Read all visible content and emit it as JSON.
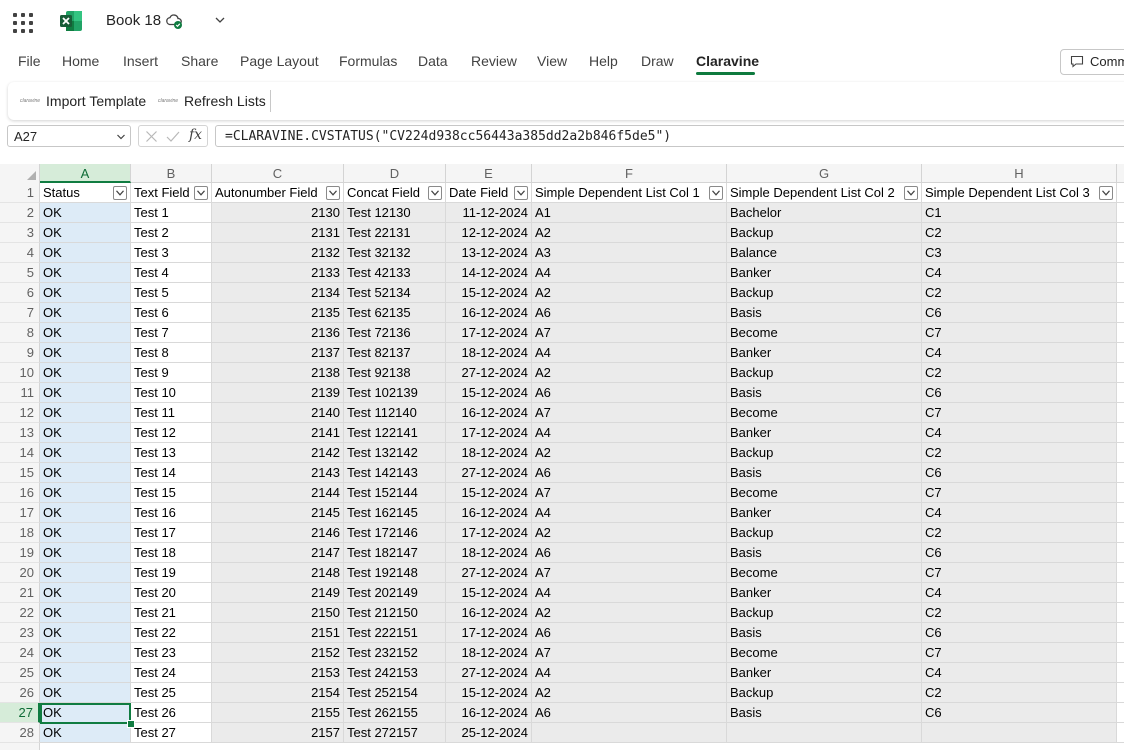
{
  "app": {
    "title": "Book 18",
    "icons": {
      "launcher": "app-launcher-icon",
      "logo": "excel-logo-icon",
      "sync": "cloud-saved-icon",
      "more": "chevron-down-icon"
    },
    "accent": "#107c41"
  },
  "menu": {
    "items": [
      "File",
      "Home",
      "Insert",
      "Share",
      "Page Layout",
      "Formulas",
      "Data",
      "Review",
      "View",
      "Help",
      "Draw",
      "Claravine"
    ],
    "active": "Claravine",
    "comments_label": "Comm"
  },
  "ribbon": {
    "logo_text": "claravine",
    "import_label": "Import Template",
    "refresh_label": "Refresh Lists"
  },
  "formula_bar": {
    "name_box": "A27",
    "fx": "fx",
    "formula": "=CLARAVINE.CVSTATUS(\"CV224d938cc56443a385dd2a2b846f5de5\")"
  },
  "sheet": {
    "columns": [
      "A",
      "B",
      "C",
      "D",
      "E",
      "F",
      "G",
      "H"
    ],
    "selected_column": "A",
    "selected_row": 27,
    "headers": [
      "Status",
      "Text Field",
      "Autonumber Field",
      "Concat Field",
      "Date Field",
      "Simple Dependent List Col 1",
      "Simple Dependent List Col 2",
      "Simple Dependent List Col 3"
    ],
    "rows": [
      {
        "n": "2",
        "cells": [
          "OK",
          "Test 1",
          "2130",
          "Test 12130",
          "11-12-2024",
          "A1",
          "Bachelor",
          "C1"
        ]
      },
      {
        "n": "3",
        "cells": [
          "OK",
          "Test 2",
          "2131",
          "Test 22131",
          "12-12-2024",
          "A2",
          "Backup",
          "C2"
        ]
      },
      {
        "n": "4",
        "cells": [
          "OK",
          "Test 3",
          "2132",
          "Test 32132",
          "13-12-2024",
          "A3",
          "Balance",
          "C3"
        ]
      },
      {
        "n": "5",
        "cells": [
          "OK",
          "Test 4",
          "2133",
          "Test 42133",
          "14-12-2024",
          "A4",
          "Banker",
          "C4"
        ]
      },
      {
        "n": "6",
        "cells": [
          "OK",
          "Test 5",
          "2134",
          "Test 52134",
          "15-12-2024",
          "A2",
          "Backup",
          "C2"
        ]
      },
      {
        "n": "7",
        "cells": [
          "OK",
          "Test 6",
          "2135",
          "Test 62135",
          "16-12-2024",
          "A6",
          "Basis",
          "C6"
        ]
      },
      {
        "n": "8",
        "cells": [
          "OK",
          "Test 7",
          "2136",
          "Test 72136",
          "17-12-2024",
          "A7",
          "Become",
          "C7"
        ]
      },
      {
        "n": "9",
        "cells": [
          "OK",
          "Test 8",
          "2137",
          "Test 82137",
          "18-12-2024",
          "A4",
          "Banker",
          "C4"
        ]
      },
      {
        "n": "10",
        "cells": [
          "OK",
          "Test 9",
          "2138",
          "Test 92138",
          "27-12-2024",
          "A2",
          "Backup",
          "C2"
        ]
      },
      {
        "n": "11",
        "cells": [
          "OK",
          "Test 10",
          "2139",
          "Test 102139",
          "15-12-2024",
          "A6",
          "Basis",
          "C6"
        ]
      },
      {
        "n": "12",
        "cells": [
          "OK",
          "Test 11",
          "2140",
          "Test 112140",
          "16-12-2024",
          "A7",
          "Become",
          "C7"
        ]
      },
      {
        "n": "13",
        "cells": [
          "OK",
          "Test 12",
          "2141",
          "Test 122141",
          "17-12-2024",
          "A4",
          "Banker",
          "C4"
        ]
      },
      {
        "n": "14",
        "cells": [
          "OK",
          "Test 13",
          "2142",
          "Test 132142",
          "18-12-2024",
          "A2",
          "Backup",
          "C2"
        ]
      },
      {
        "n": "15",
        "cells": [
          "OK",
          "Test 14",
          "2143",
          "Test 142143",
          "27-12-2024",
          "A6",
          "Basis",
          "C6"
        ]
      },
      {
        "n": "16",
        "cells": [
          "OK",
          "Test 15",
          "2144",
          "Test 152144",
          "15-12-2024",
          "A7",
          "Become",
          "C7"
        ]
      },
      {
        "n": "17",
        "cells": [
          "OK",
          "Test 16",
          "2145",
          "Test 162145",
          "16-12-2024",
          "A4",
          "Banker",
          "C4"
        ]
      },
      {
        "n": "18",
        "cells": [
          "OK",
          "Test 17",
          "2146",
          "Test 172146",
          "17-12-2024",
          "A2",
          "Backup",
          "C2"
        ]
      },
      {
        "n": "19",
        "cells": [
          "OK",
          "Test 18",
          "2147",
          "Test 182147",
          "18-12-2024",
          "A6",
          "Basis",
          "C6"
        ]
      },
      {
        "n": "20",
        "cells": [
          "OK",
          "Test 19",
          "2148",
          "Test 192148",
          "27-12-2024",
          "A7",
          "Become",
          "C7"
        ]
      },
      {
        "n": "21",
        "cells": [
          "OK",
          "Test 20",
          "2149",
          "Test 202149",
          "15-12-2024",
          "A4",
          "Banker",
          "C4"
        ]
      },
      {
        "n": "22",
        "cells": [
          "OK",
          "Test 21",
          "2150",
          "Test 212150",
          "16-12-2024",
          "A2",
          "Backup",
          "C2"
        ]
      },
      {
        "n": "23",
        "cells": [
          "OK",
          "Test 22",
          "2151",
          "Test 222151",
          "17-12-2024",
          "A6",
          "Basis",
          "C6"
        ]
      },
      {
        "n": "24",
        "cells": [
          "OK",
          "Test 23",
          "2152",
          "Test 232152",
          "18-12-2024",
          "A7",
          "Become",
          "C7"
        ]
      },
      {
        "n": "25",
        "cells": [
          "OK",
          "Test 24",
          "2153",
          "Test 242153",
          "27-12-2024",
          "A4",
          "Banker",
          "C4"
        ]
      },
      {
        "n": "26",
        "cells": [
          "OK",
          "Test 25",
          "2154",
          "Test 252154",
          "15-12-2024",
          "A2",
          "Backup",
          "C2"
        ]
      },
      {
        "n": "27",
        "cells": [
          "OK",
          "Test 26",
          "2155",
          "Test 262155",
          "16-12-2024",
          "A6",
          "Basis",
          "C6"
        ]
      },
      {
        "n": "28",
        "cells": [
          "OK",
          "Test 27",
          "2157",
          "Test 272157",
          "25-12-2024",
          "",
          "",
          ""
        ]
      }
    ],
    "colors": {
      "status_column": "#ddebf7",
      "locked_columns": "#ebebeb",
      "plain": "#ffffff"
    }
  }
}
